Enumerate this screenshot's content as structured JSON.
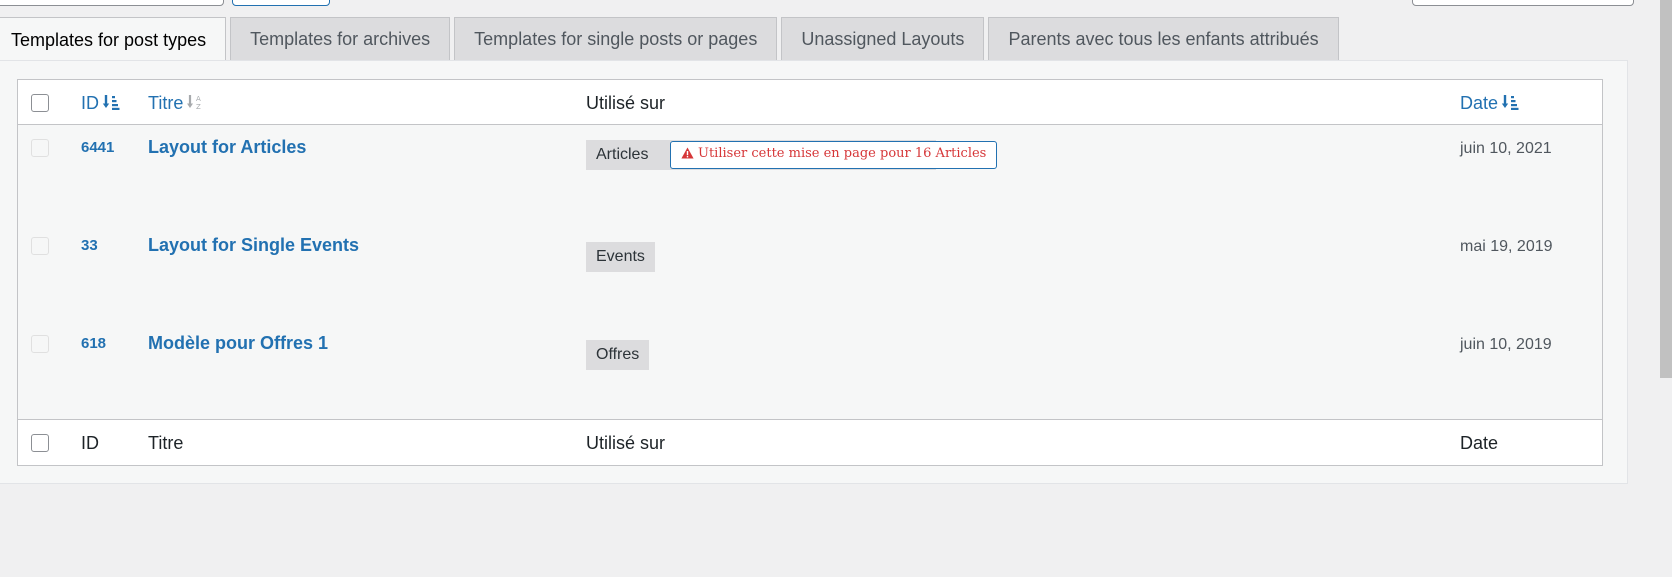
{
  "tabs": [
    {
      "label": "Templates for post types",
      "active": true
    },
    {
      "label": "Templates for archives"
    },
    {
      "label": "Templates for single posts or pages"
    },
    {
      "label": "Unassigned Layouts"
    },
    {
      "label": "Parents avec tous les enfants attribués"
    }
  ],
  "table": {
    "headers": {
      "id": "ID",
      "title": "Titre",
      "used_on": "Utilisé sur",
      "date": "Date"
    },
    "footers": {
      "id": "ID",
      "title": "Titre",
      "used_on": "Utilisé sur",
      "date": "Date"
    },
    "rows": [
      {
        "id": "6441",
        "title": "Layout for Articles",
        "used_on": "Articles",
        "warning": "Utiliser cette mise en page pour 16 Articles",
        "date": "juin 10, 2021"
      },
      {
        "id": "33",
        "title": "Layout for Single Events",
        "used_on": "Events",
        "date": "mai 19, 2019"
      },
      {
        "id": "618",
        "title": "Modèle pour Offres 1",
        "used_on": "Offres",
        "date": "juin 10, 2019"
      }
    ]
  },
  "icons": {
    "id_sort": "sort-numeric-desc-icon",
    "title_sort": "sort-alpha-icon",
    "date_sort": "sort-desc-icon",
    "warning": "warning-triangle-icon"
  },
  "colors": {
    "link": "#2271b1",
    "warning": "#d63638",
    "tag_bg": "#dcdcde"
  }
}
